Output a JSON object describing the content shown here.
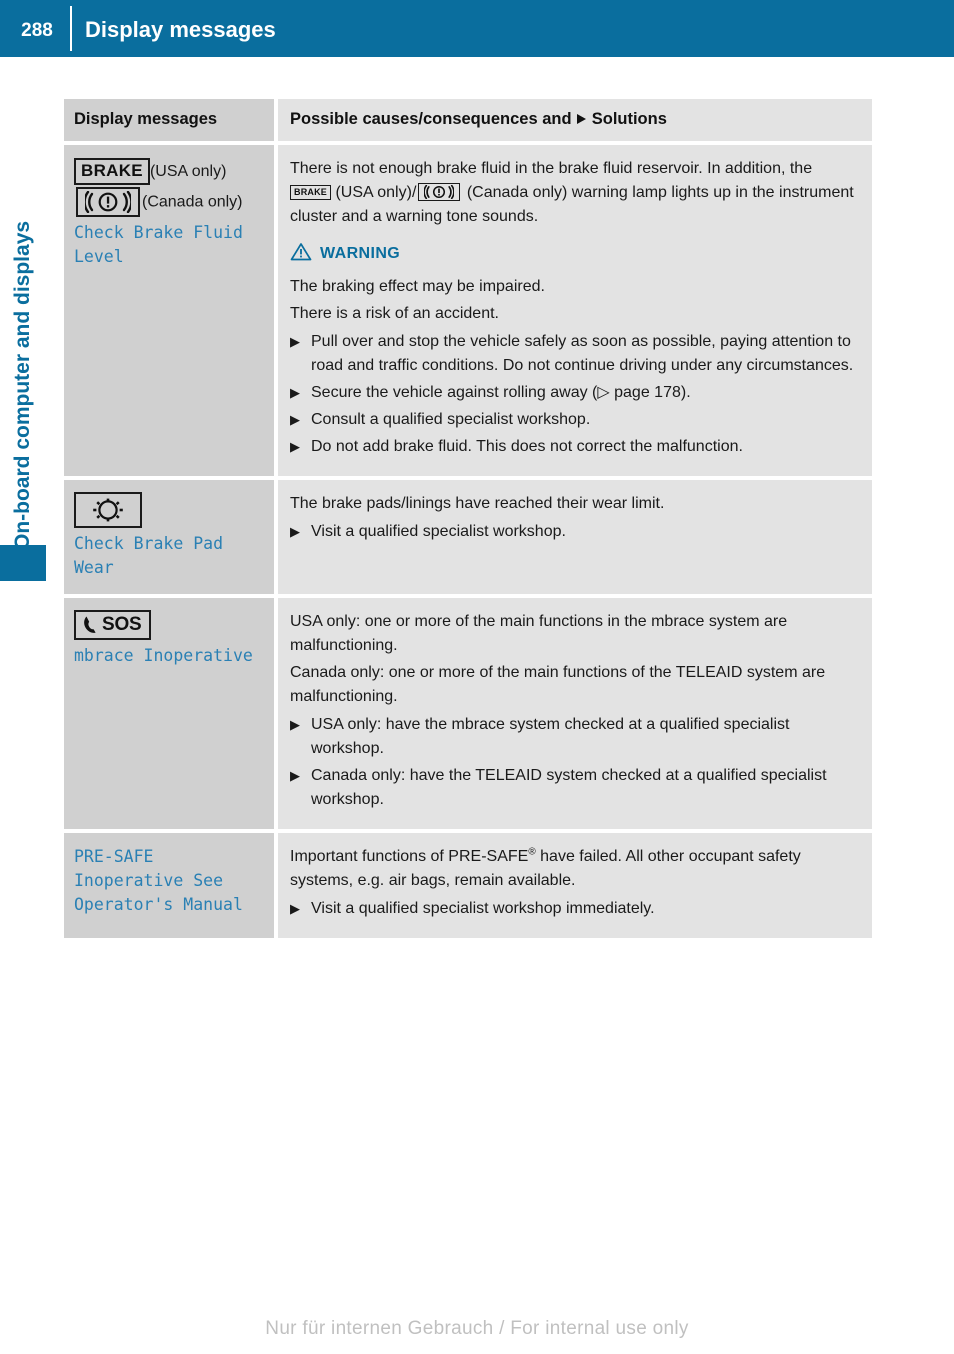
{
  "header": {
    "page_number": "288",
    "title": "Display messages"
  },
  "side_tab": {
    "chapter_label": "On-board computer and displays"
  },
  "table": {
    "columns": {
      "left_header": "Display messages",
      "right_header_prefix": "Possible causes/consequences and",
      "right_header_suffix": "Solutions"
    },
    "rows": [
      {
        "id": "check-brake-fluid-level",
        "left": {
          "icon_usa": "BRAKE",
          "label_usa": "(USA only)",
          "icon_canada": "brake-warning-lamp-icon",
          "label_canada": "(Canada only)",
          "message": "Check Brake Fluid Level"
        },
        "right": {
          "intro_part1": "There is not enough brake fluid in the brake fluid reservoir. In addition, the",
          "intro_icon_usa": "BRAKE",
          "intro_part2": "(USA only)/",
          "intro_icon_canada": "brake-warning-lamp-icon",
          "intro_part3": "(Canada only) warning lamp lights up in the instrument cluster and a warning tone sounds.",
          "warning_label": "WARNING",
          "warning_lines": [
            "The braking effect may be impaired.",
            "There is a risk of an accident."
          ],
          "bullets": [
            "Pull over and stop the vehicle safely as soon as possible, paying attention to road and traffic conditions. Do not continue driving under any circumstances.",
            "Secure the vehicle against rolling away (▷ page 178).",
            "Consult a qualified specialist workshop.",
            "Do not add brake fluid. This does not correct the malfunction."
          ]
        }
      },
      {
        "id": "check-brake-pad-wear",
        "left": {
          "icon": "brake-pad-wear-icon",
          "message": "Check Brake Pad Wear"
        },
        "right": {
          "intro": "The brake pads/linings have reached their wear limit.",
          "bullets": [
            "Visit a qualified specialist workshop."
          ]
        }
      },
      {
        "id": "mbrace-inoperative",
        "left": {
          "icon": "sos-phone-icon",
          "icon_text": "SOS",
          "message": "mbrace Inoperative"
        },
        "right": {
          "paragraphs": [
            "USA only: one or more of the main functions in the mbrace system are malfunctioning.",
            "Canada only: one or more of the main functions of the TELEAID system are malfunctioning."
          ],
          "bullets": [
            "USA only: have the mbrace system checked at a qualified specialist workshop.",
            "Canada only: have the TELEAID system checked at a qualified specialist workshop."
          ]
        }
      },
      {
        "id": "pre-safe-inoperative",
        "left": {
          "message": "PRE-SAFE Inoperative See Operator's Manual"
        },
        "right": {
          "intro_part1": "Important functions of PRE-SAFE",
          "intro_reg": "®",
          "intro_part2": " have failed. All other occupant safety systems, e.g. air bags, remain available.",
          "bullets": [
            "Visit a qualified specialist workshop immediately."
          ]
        }
      }
    ]
  },
  "footer": {
    "watermark": "Nur für internen Gebrauch / For internal use only"
  },
  "colors": {
    "brand_blue": "#0a6e9e",
    "message_blue": "#2a80b4",
    "left_cell_grey": "#d0d0d0",
    "right_cell_grey": "#e3e3e3"
  }
}
